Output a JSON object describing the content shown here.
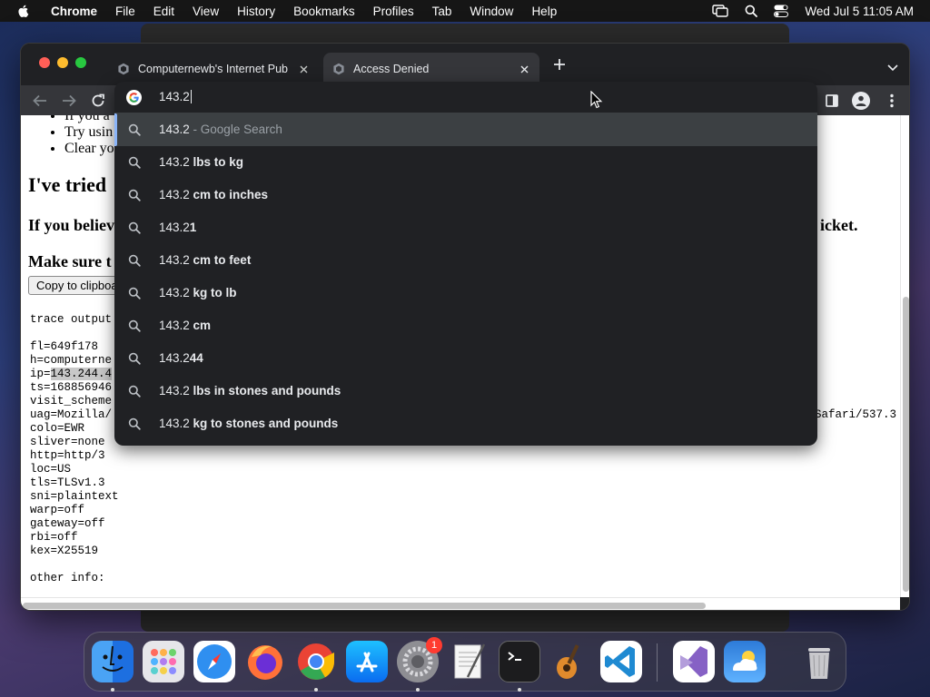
{
  "menubar": {
    "items": [
      "Chrome",
      "File",
      "Edit",
      "View",
      "History",
      "Bookmarks",
      "Profiles",
      "Tab",
      "Window",
      "Help"
    ],
    "clock": "Wed Jul 5  11:05 AM"
  },
  "tabs": [
    {
      "title": "Computernewb's Internet Pub",
      "active": false
    },
    {
      "title": "Access Denied",
      "active": true
    }
  ],
  "omnibox": {
    "value": "143.2",
    "suggestions": [
      {
        "bold": "143.2",
        "rest": "",
        "desc": " - Google Search",
        "selected": true
      },
      {
        "bold": "143.2",
        "rest": " lbs to kg",
        "desc": ""
      },
      {
        "bold": "143.2",
        "rest": " cm to inches",
        "desc": ""
      },
      {
        "bold": "143.2",
        "rest": "1",
        "desc": ""
      },
      {
        "bold": "143.2",
        "rest": " cm to feet",
        "desc": ""
      },
      {
        "bold": "143.2",
        "rest": " kg to lb",
        "desc": ""
      },
      {
        "bold": "143.2",
        "rest": " cm",
        "desc": ""
      },
      {
        "bold": "143.2",
        "rest": "44",
        "desc": ""
      },
      {
        "bold": "143.2",
        "rest": " lbs in stones and pounds",
        "desc": ""
      },
      {
        "bold": "143.2",
        "rest": " kg to stones and pounds",
        "desc": ""
      }
    ]
  },
  "page": {
    "bullets": [
      "If you a",
      "Try usin",
      "Clear yo"
    ],
    "heading_tried": "I've tried",
    "heading_believe": "If you believ",
    "heading_believe_tail": "icket.",
    "heading_make_sure": "Make sure t",
    "copy_button": "Copy to clipboa",
    "trace_header": "trace output",
    "trace_lines": [
      "fl=649f178",
      "h=computerne",
      "ip=143.244.4",
      "ts=168856946",
      "visit_scheme",
      "uag=Mozilla/",
      "colo=EWR",
      "sliver=none",
      "http=http/3",
      "loc=US",
      "tls=TLSv1.3",
      "sni=plaintext",
      "warp=off",
      "gateway=off",
      "rbi=off",
      "kex=X25519"
    ],
    "uag_tail": "Safari/537.3",
    "other_info": "other info:"
  },
  "dock": {
    "apps": [
      "Finder",
      "Launchpad",
      "Safari",
      "Firefox",
      "Chrome",
      "App Store",
      "System Settings",
      "TextEdit",
      "Terminal",
      "GarageBand",
      "Visual Studio Code",
      "Visual Studio",
      "Weather",
      "Trash"
    ],
    "settings_badge": "1"
  }
}
